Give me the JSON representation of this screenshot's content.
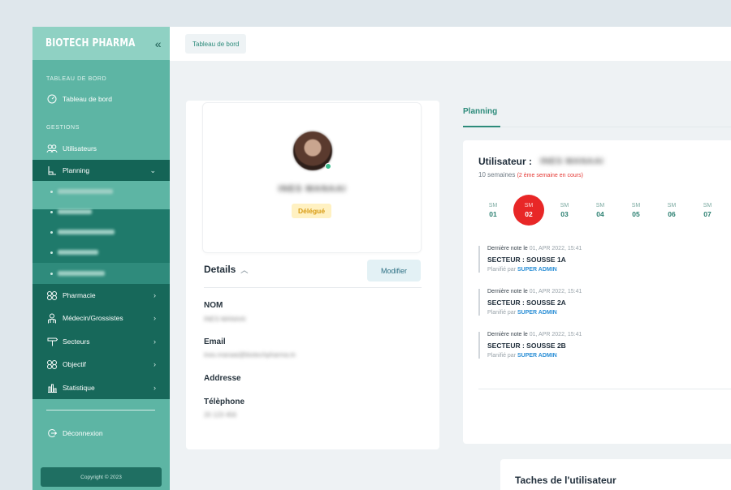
{
  "sidebar": {
    "brand": "BIOTECH PHARMA",
    "toggle_icon": "double-chevron-left-icon",
    "section_dashboard": "TABLEAU DE BORD",
    "dashboard_item": "Tableau de bord",
    "section_gestions": "GESTIONS",
    "items": [
      {
        "label": "Utilisateurs",
        "icon": "users-icon"
      },
      {
        "label": "Planning",
        "icon": "planning-icon"
      },
      {
        "label": "Pharmacie",
        "icon": "pharmacy-icon"
      },
      {
        "label": "Médecin/Grossistes",
        "icon": "doctor-icon"
      },
      {
        "label": "Secteurs",
        "icon": "signpost-icon"
      },
      {
        "label": "Objectif",
        "icon": "objective-icon"
      },
      {
        "label": "Statistique",
        "icon": "bar-chart-icon"
      }
    ],
    "logout": "Déconnexion",
    "copyright": "Copyright © 2023"
  },
  "topbar": {
    "breadcrumb": "Tableau de bord"
  },
  "profile": {
    "name": "INES MANAAI",
    "role": "Délégué",
    "details_title": "Details",
    "modify_button": "Modifier",
    "fields": [
      {
        "label": "NOM",
        "value": "INES MANAAI"
      },
      {
        "label": "Email",
        "value": "ines.manaai@biotechpharma.tn"
      },
      {
        "label": "Addresse",
        "value": ""
      },
      {
        "label": "Télèphone",
        "value": "20 123 456"
      }
    ]
  },
  "planning": {
    "tab_label": "Planning",
    "user_label": "Utilisateur :",
    "user_name": "INES MANAAI",
    "weeks_count": "10 semaines",
    "weeks_current": "(2 ème semaine en cours)",
    "weeks": [
      {
        "label": "SM",
        "num": "01",
        "active": false
      },
      {
        "label": "SM",
        "num": "02",
        "active": true
      },
      {
        "label": "SM",
        "num": "03",
        "active": false
      },
      {
        "label": "SM",
        "num": "04",
        "active": false
      },
      {
        "label": "SM",
        "num": "05",
        "active": false
      },
      {
        "label": "SM",
        "num": "06",
        "active": false
      },
      {
        "label": "SM",
        "num": "07",
        "active": false
      }
    ],
    "notes": [
      {
        "meta": "Dernière note le",
        "date": "01, APR 2022, 15:41",
        "sector": "SECTEUR : SOUSSE 1A",
        "planned_by": "Planifié par",
        "who": "SUPER ADMIN"
      },
      {
        "meta": "Dernière note le",
        "date": "01, APR 2022, 15:41",
        "sector": "SECTEUR : SOUSSE 2A",
        "planned_by": "Planifié par",
        "who": "SUPER ADMIN"
      },
      {
        "meta": "Dernière note le",
        "date": "01, APR 2022, 15:41",
        "sector": "SECTEUR : SOUSSE 2B",
        "planned_by": "Planifié par",
        "who": "SUPER ADMIN"
      }
    ]
  },
  "tasks": {
    "title": "Taches de l'utilisateur"
  },
  "colors": {
    "sidebar": "#5db5a4",
    "sidebar_dark": "#17685a",
    "accent": "#2c8b7a",
    "active_week": "#e82727",
    "badge_bg": "#fff1c2",
    "badge_text": "#d89b14",
    "link": "#2b8fd6"
  }
}
